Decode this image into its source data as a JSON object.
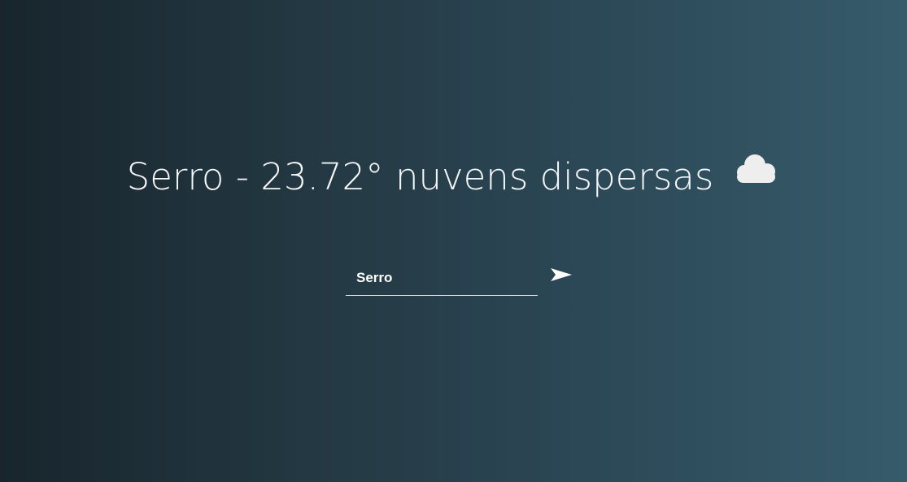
{
  "weather": {
    "headline": "Serro - 23.72° nuvens dispersas",
    "icon": "cloud-icon"
  },
  "search": {
    "value": "Serro",
    "submit_icon": "send-arrow-icon"
  },
  "colors": {
    "gradient_start": "#18252d",
    "gradient_end": "#365b6b",
    "text": "#f4f6f7",
    "cloud": "#eeeeee"
  }
}
